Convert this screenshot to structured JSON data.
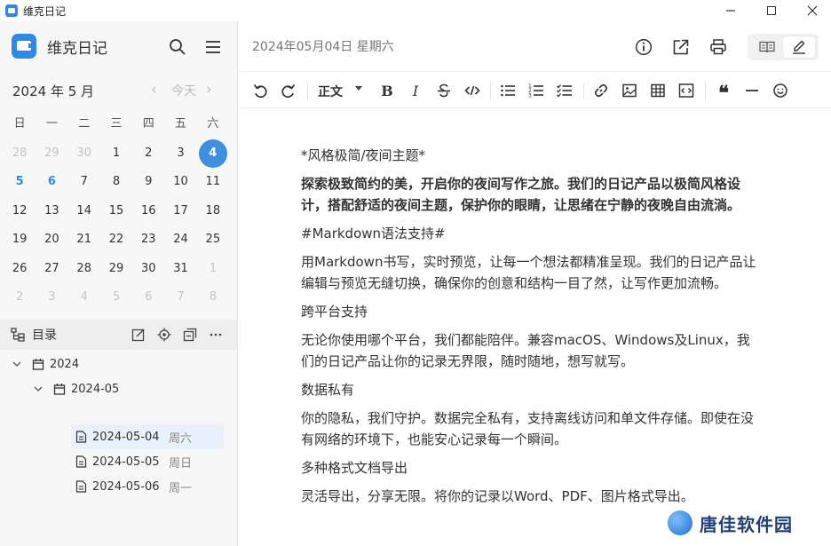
{
  "window": {
    "title": "维克日记"
  },
  "sidebar": {
    "brand": "维克日记",
    "calendar": {
      "month_label": "2024 年 5 月",
      "prev": "‹",
      "next": "›",
      "today": "今天",
      "weekdays": [
        "日",
        "一",
        "二",
        "三",
        "四",
        "五",
        "六"
      ],
      "weeks": [
        [
          "28",
          "29",
          "30",
          "1",
          "2",
          "3",
          "4"
        ],
        [
          "5",
          "6",
          "7",
          "8",
          "9",
          "10",
          "11"
        ],
        [
          "12",
          "13",
          "14",
          "15",
          "16",
          "17",
          "18"
        ],
        [
          "19",
          "20",
          "21",
          "22",
          "23",
          "24",
          "25"
        ],
        [
          "26",
          "27",
          "28",
          "29",
          "30",
          "31",
          "1"
        ],
        [
          "2",
          "3",
          "4",
          "5",
          "6",
          "7",
          "8"
        ]
      ],
      "selected_day": "4",
      "accent_color": "#3d8fe0"
    },
    "toc": {
      "label": "目录",
      "tree": [
        {
          "label": "2024",
          "level": 0
        },
        {
          "label": "2024-05",
          "level": 1
        },
        {
          "label": "2024-05-04",
          "weekday": "周六",
          "level": 2,
          "active": true
        },
        {
          "label": "2024-05-05",
          "weekday": "周日",
          "level": 2
        },
        {
          "label": "2024-05-06",
          "weekday": "周一",
          "level": 2
        }
      ]
    }
  },
  "main": {
    "date_title": "2024年05月04日 星期六",
    "toolbar": {
      "heading": "正文"
    },
    "content": [
      {
        "text": "*风格极简/夜间主题*",
        "bold": false
      },
      {
        "text": "探索极致简约的美，开启你的夜间写作之旅。我们的日记产品以极简风格设计，搭配舒适的夜间主题，保护你的眼睛，让思绪在宁静的夜晚自由流淌。",
        "bold": true
      },
      {
        "text": "#Markdown语法支持#",
        "bold": false
      },
      {
        "text": "用Markdown书写，实时预览，让每一个想法都精准呈现。我们的日记产品让编辑与预览无缝切换，确保你的创意和结构一目了然，让写作更加流畅。",
        "bold": false
      },
      {
        "text": "跨平台支持",
        "bold": false
      },
      {
        "text": "无论你使用哪个平台，我们都能陪伴。兼容macOS、Windows及Linux，我们的日记产品让你的记录无界限，随时随地，想写就写。",
        "bold": false
      },
      {
        "text": "数据私有",
        "bold": false
      },
      {
        "text": "你的隐私，我们守护。数据完全私有，支持离线访问和单文件存储。即使在没有网络的环境下，也能安心记录每一个瞬间。",
        "bold": false
      },
      {
        "text": "多种格式文档导出",
        "bold": false
      },
      {
        "text": "灵活导出，分享无限。将你的记录以Word、PDF、图片格式导出。",
        "bold": false
      }
    ]
  },
  "watermark": {
    "text": "唐佳软件园"
  }
}
